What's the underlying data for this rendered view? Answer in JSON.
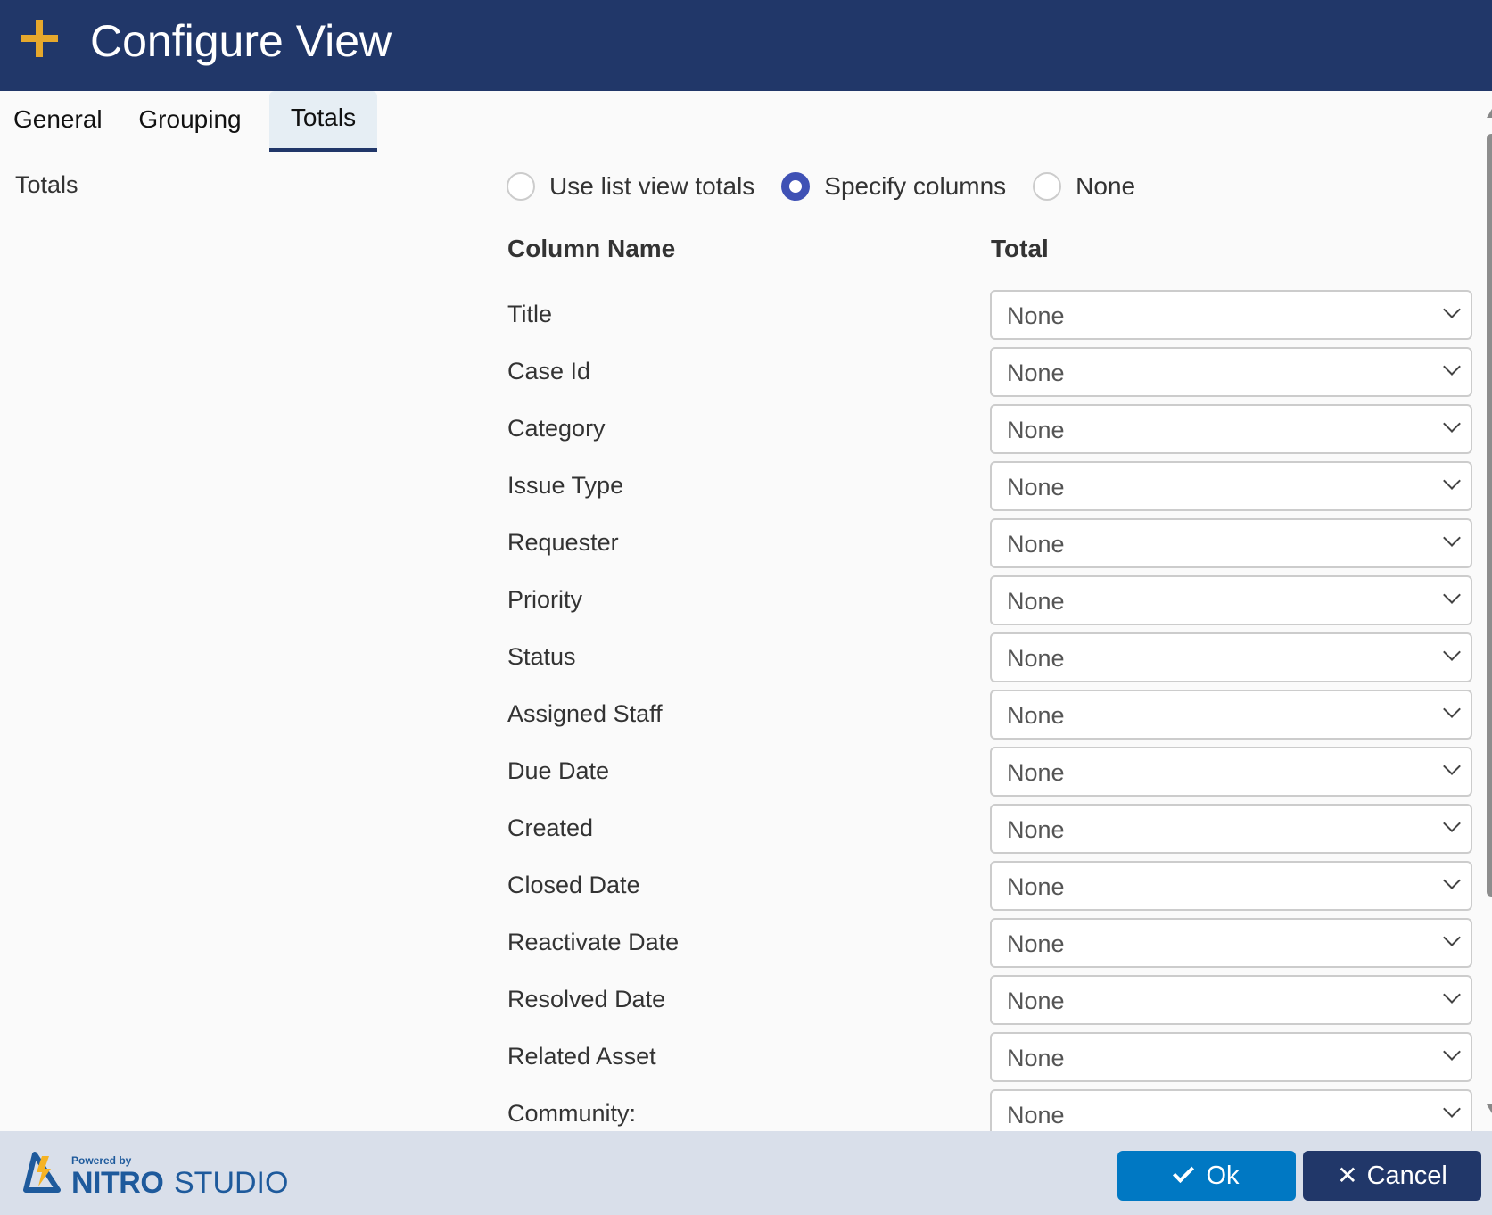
{
  "header": {
    "title": "Configure View",
    "icon": "plus-icon"
  },
  "tabs": [
    {
      "label": "General",
      "active": false
    },
    {
      "label": "Grouping",
      "active": false
    },
    {
      "label": "Totals",
      "active": true
    }
  ],
  "totals": {
    "section_label": "Totals",
    "mode_options": [
      {
        "label": "Use list view totals",
        "checked": false
      },
      {
        "label": "Specify columns",
        "checked": true
      },
      {
        "label": "None",
        "checked": false
      }
    ],
    "column_header": "Column Name",
    "total_header": "Total",
    "rows": [
      {
        "name": "Title",
        "total": "None"
      },
      {
        "name": "Case Id",
        "total": "None"
      },
      {
        "name": "Category",
        "total": "None"
      },
      {
        "name": "Issue Type",
        "total": "None"
      },
      {
        "name": "Requester",
        "total": "None"
      },
      {
        "name": "Priority",
        "total": "None"
      },
      {
        "name": "Status",
        "total": "None"
      },
      {
        "name": "Assigned Staff",
        "total": "None"
      },
      {
        "name": "Due Date",
        "total": "None"
      },
      {
        "name": "Created",
        "total": "None"
      },
      {
        "name": "Closed Date",
        "total": "None"
      },
      {
        "name": "Reactivate Date",
        "total": "None"
      },
      {
        "name": "Resolved Date",
        "total": "None"
      },
      {
        "name": "Related Asset",
        "total": "None"
      },
      {
        "name": "Community:",
        "total": "None"
      }
    ]
  },
  "footer": {
    "logo_powered": "Powered by",
    "logo_nitro": "NITRO",
    "logo_studio": "STUDIO",
    "ok_label": "Ok",
    "cancel_label": "Cancel"
  },
  "colors": {
    "header_bg": "#213769",
    "accent_gold": "#e6a82c",
    "radio_selected": "#3f51b5",
    "ok_button": "#0078c3",
    "cancel_button": "#213769",
    "footer_bg": "#d9dfea"
  }
}
